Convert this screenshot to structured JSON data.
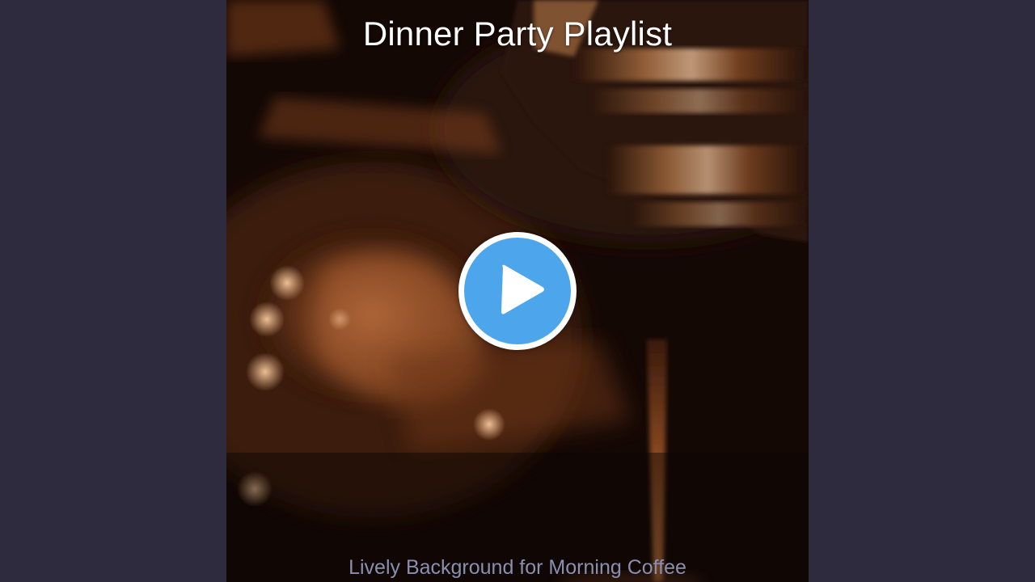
{
  "video": {
    "title": "Dinner Party Playlist",
    "subtitle": "Lively Background for Morning Coffee"
  },
  "player": {
    "play_icon": "play-icon",
    "button_color": "#4da6ec",
    "ring_color": "#ffffff"
  },
  "colors": {
    "page_background": "#2f2b3e",
    "title_text": "#ffffff",
    "subtitle_text": "#8a8fb0"
  }
}
